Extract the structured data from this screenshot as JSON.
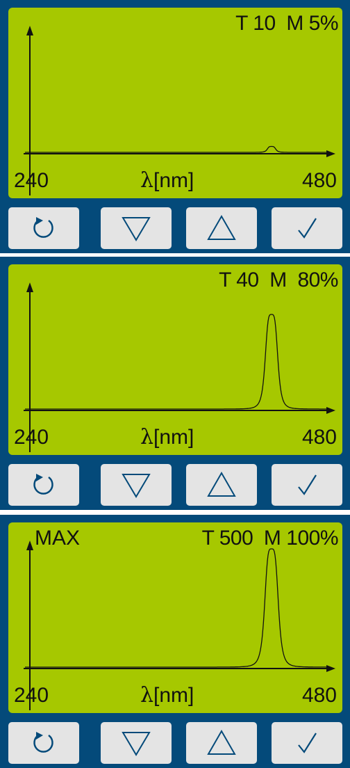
{
  "panels": [
    {
      "status": "T 10  M 5%",
      "max_label": "",
      "axis": {
        "x_min": "240",
        "x_max": "480",
        "x_label_symbol": "λ",
        "x_label_unit": "[nm]"
      },
      "peak": {
        "level": 0.05
      }
    },
    {
      "status": "T 40  M  80%",
      "max_label": "",
      "axis": {
        "x_min": "240",
        "x_max": "480",
        "x_label_symbol": "λ",
        "x_label_unit": "[nm]"
      },
      "peak": {
        "level": 0.8
      }
    },
    {
      "status": "T 500  M 100%",
      "max_label": "MAX",
      "axis": {
        "x_min": "240",
        "x_max": "480",
        "x_label_symbol": "λ",
        "x_label_unit": "[nm]"
      },
      "peak": {
        "level": 1.0,
        "clipped": true
      }
    }
  ],
  "buttons": [
    {
      "icon": "reset-icon"
    },
    {
      "icon": "decrease-triangle-icon"
    },
    {
      "icon": "increase-triangle-icon"
    },
    {
      "icon": "confirm-check-icon"
    }
  ],
  "colors": {
    "frame": "#044a7a",
    "display": "#a6c800",
    "button": "#e4e4e4",
    "ink": "#111111"
  }
}
